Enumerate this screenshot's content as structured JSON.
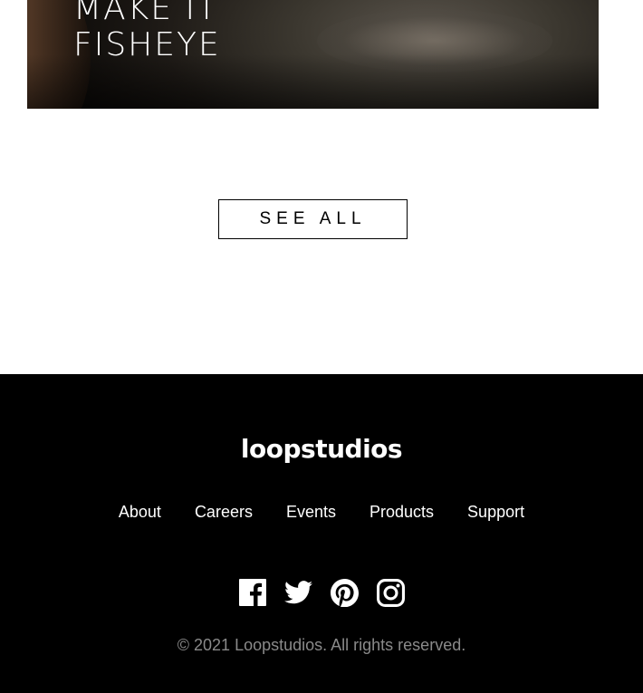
{
  "card": {
    "title": "MAKE IT\nFISHEYE"
  },
  "see_all": {
    "label": "SEE ALL"
  },
  "footer": {
    "logo": "loopstudios",
    "nav": [
      {
        "label": "About"
      },
      {
        "label": "Careers"
      },
      {
        "label": "Events"
      },
      {
        "label": "Products"
      },
      {
        "label": "Support"
      }
    ],
    "socials": [
      {
        "icon": "facebook-icon"
      },
      {
        "icon": "twitter-icon"
      },
      {
        "icon": "pinterest-icon"
      },
      {
        "icon": "instagram-icon"
      }
    ],
    "copyright": "© 2021 Loopstudios. All rights reserved."
  },
  "colors": {
    "footer_background": "#000000",
    "footer_text": "#ffffff",
    "copyright_text": "#8a8a8a",
    "button_border": "#000000"
  }
}
